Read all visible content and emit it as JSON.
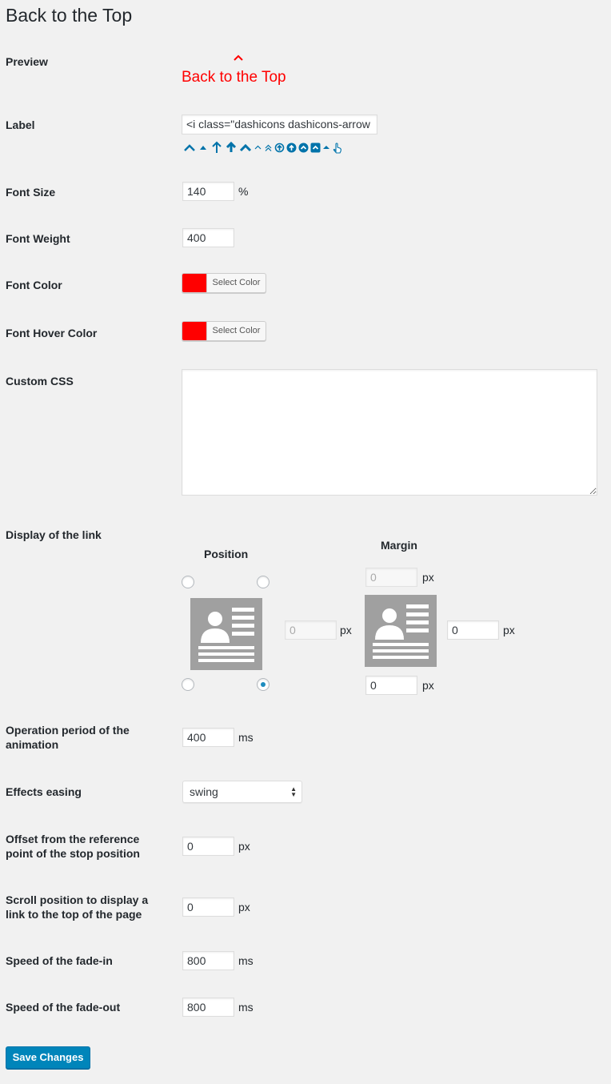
{
  "page": {
    "title": "Back to the Top"
  },
  "preview": {
    "label": "Preview",
    "arrow_icon": "chevron-up-icon",
    "text": "Back to the Top",
    "color": "#ff0000"
  },
  "label_field": {
    "label": "Label",
    "value": "<i class=\"dashicons dashicons-arrow",
    "icon_options": [
      "arrow-up-alt2",
      "arrow-up",
      "arrow-up-alt",
      "up-bold",
      "chevron-up-bold",
      "chevron-up-small",
      "double-chevron-up",
      "circle-arrow-up",
      "circle-arrow-up-filled",
      "circle-chevron-up",
      "square-chevron-up",
      "triangle-up",
      "hand-pointer"
    ],
    "icon_color": "#0073aa"
  },
  "font_size": {
    "label": "Font Size",
    "value": "140",
    "unit": "%"
  },
  "font_weight": {
    "label": "Font Weight",
    "value": "400"
  },
  "font_color": {
    "label": "Font Color",
    "button": "Select Color",
    "color": "#ff0000"
  },
  "font_hover_color": {
    "label": "Font Hover Color",
    "button": "Select Color",
    "color": "#ff0000"
  },
  "custom_css": {
    "label": "Custom CSS",
    "value": ""
  },
  "display": {
    "label": "Display of the link",
    "position_heading": "Position",
    "margin_heading": "Margin",
    "selected_position": "bottom-right",
    "side_margin": {
      "value": "0",
      "unit": "px"
    },
    "margin_top": {
      "value": "0",
      "unit": "px"
    },
    "margin_right": {
      "value": "0",
      "unit": "px"
    },
    "margin_bottom": {
      "value": "0",
      "unit": "px"
    }
  },
  "animation_period": {
    "label": "Operation period of the animation",
    "value": "400",
    "unit": "ms"
  },
  "easing": {
    "label": "Effects easing",
    "value": "swing"
  },
  "stop_offset": {
    "label": "Offset from the reference point of the stop position",
    "value": "0",
    "unit": "px"
  },
  "scroll_position": {
    "label": "Scroll position to display a link to the top of the page",
    "value": "0",
    "unit": "px"
  },
  "fade_in": {
    "label": "Speed of the fade-in",
    "value": "800",
    "unit": "ms"
  },
  "fade_out": {
    "label": "Speed of the fade-out",
    "value": "800",
    "unit": "ms"
  },
  "save_button": {
    "label": "Save Changes",
    "color": "#0085ba"
  }
}
